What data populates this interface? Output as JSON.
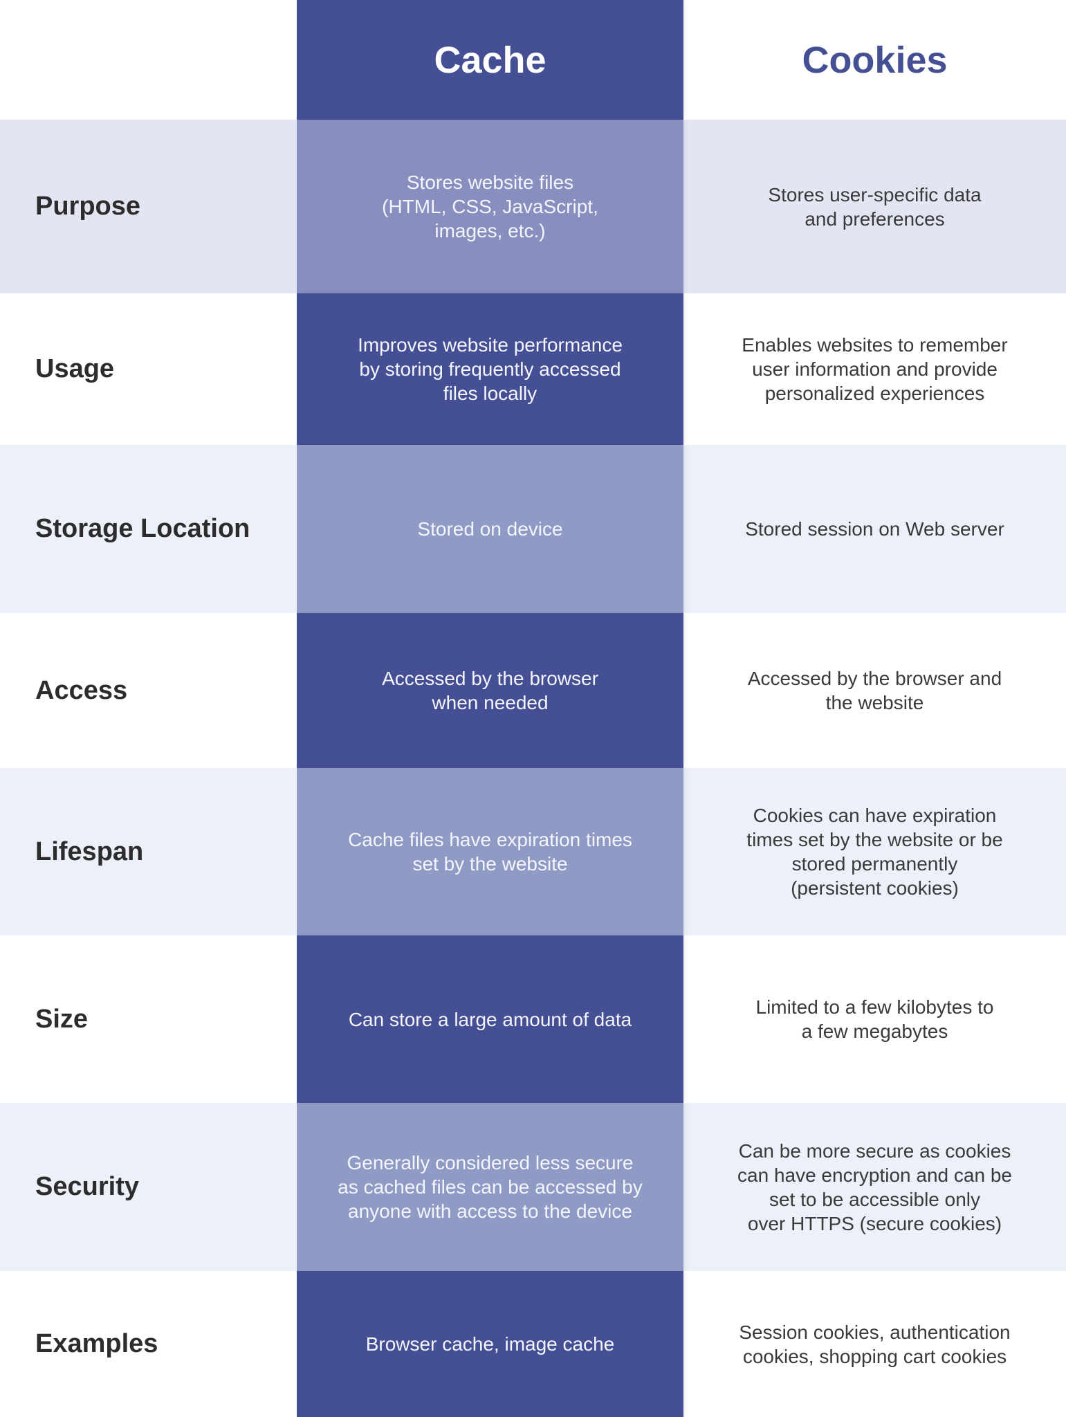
{
  "header": {
    "cache_title": "Cache",
    "cookies_title": "Cookies"
  },
  "colors": {
    "accent_dark": "#454F94",
    "accent_light": "#8F9AC5",
    "band_light": "#ECF0F9",
    "label_text": "#2c2c2c"
  },
  "rows": [
    {
      "label": "Purpose",
      "cache": "Stores website files\n(HTML, CSS, JavaScript,\nimages, etc.)",
      "cookies": "Stores user-specific data\nand preferences"
    },
    {
      "label": "Usage",
      "cache": "Improves website performance\nby storing frequently accessed\nfiles locally",
      "cookies": "Enables websites to remember\nuser  information and provide\npersonalized experiences"
    },
    {
      "label": "Storage Location",
      "cache": "Stored on device",
      "cookies": "Stored session on Web server"
    },
    {
      "label": "Access",
      "cache": "Accessed by the browser\nwhen needed",
      "cookies": "Accessed by the browser and\nthe website"
    },
    {
      "label": "Lifespan",
      "cache": "Cache files have expiration times\nset by the website",
      "cookies": "Cookies can have expiration\ntimes set by the website or be\nstored permanently\n(persistent cookies)"
    },
    {
      "label": "Size",
      "cache": "Can store a large amount of data",
      "cookies": "Limited to a few kilobytes to\na few megabytes"
    },
    {
      "label": "Security",
      "cache": "Generally considered less secure\nas cached files can be accessed by\nanyone with access to the device",
      "cookies": "Can be more secure as cookies\ncan have encryption and can be\nset to be  accessible  only\nover HTTPS (secure cookies)"
    },
    {
      "label": "Examples",
      "cache": "Browser cache, image cache",
      "cookies": "Session cookies, authentication\ncookies, shopping cart cookies"
    }
  ]
}
